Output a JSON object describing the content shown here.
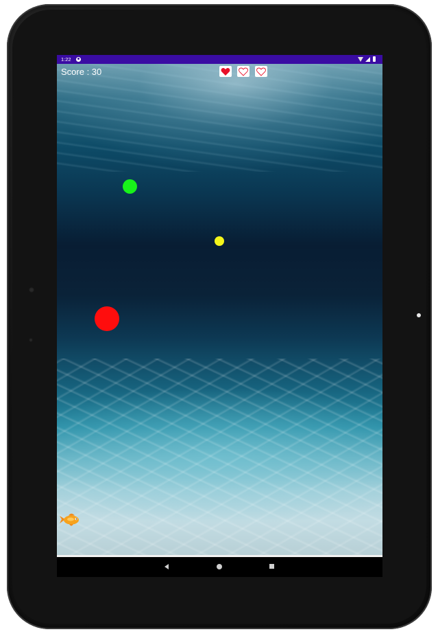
{
  "status_bar": {
    "time": "1:22",
    "icons": [
      "p-icon",
      "wifi-icon",
      "signal-icon",
      "battery-icon"
    ]
  },
  "hud": {
    "score_text": "Score : 30",
    "lives_total": 3,
    "lives_remaining": 1
  },
  "scene": {
    "background": "underwater",
    "balls": [
      {
        "name": "green-ball",
        "color": "#18f21a"
      },
      {
        "name": "yellow-ball",
        "color": "#f4f51a"
      },
      {
        "name": "red-ball",
        "color": "#ff0d0d"
      }
    ],
    "player": "goldfish-icon"
  },
  "nav_bar": {
    "buttons": [
      "back-icon",
      "home-icon",
      "recents-icon"
    ]
  },
  "colors": {
    "status_bar": "#3a0ca3",
    "heart_filled": "#e8102a",
    "heart_empty_outline": "#e8102a"
  }
}
